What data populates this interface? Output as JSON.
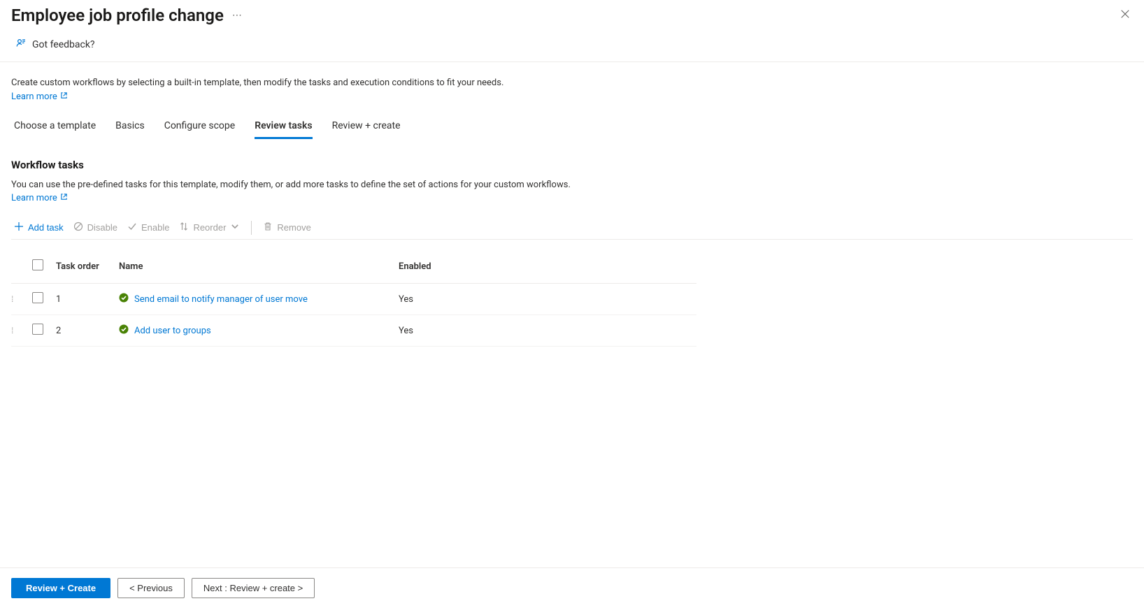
{
  "header": {
    "title": "Employee job profile change",
    "feedback_label": "Got feedback?"
  },
  "intro": {
    "text": "Create custom workflows by selecting a built-in template, then modify the tasks and execution conditions to fit your needs.",
    "learn_more": "Learn more"
  },
  "tabs": [
    {
      "label": "Choose a template"
    },
    {
      "label": "Basics"
    },
    {
      "label": "Configure scope"
    },
    {
      "label": "Review tasks"
    },
    {
      "label": "Review + create"
    }
  ],
  "section": {
    "heading": "Workflow tasks",
    "description": "You can use the pre-defined tasks for this template, modify them, or add more tasks to define the set of actions for your custom workflows.",
    "learn_more": "Learn more"
  },
  "toolbar": {
    "add": "Add task",
    "disable": "Disable",
    "enable": "Enable",
    "reorder": "Reorder",
    "remove": "Remove"
  },
  "table": {
    "columns": {
      "order": "Task order",
      "name": "Name",
      "enabled": "Enabled"
    },
    "rows": [
      {
        "order": "1",
        "name": "Send email to notify manager of user move",
        "enabled": "Yes"
      },
      {
        "order": "2",
        "name": "Add user to groups",
        "enabled": "Yes"
      }
    ]
  },
  "footer": {
    "review_create": "Review + Create",
    "previous": "<  Previous",
    "next": "Next : Review + create  >"
  }
}
